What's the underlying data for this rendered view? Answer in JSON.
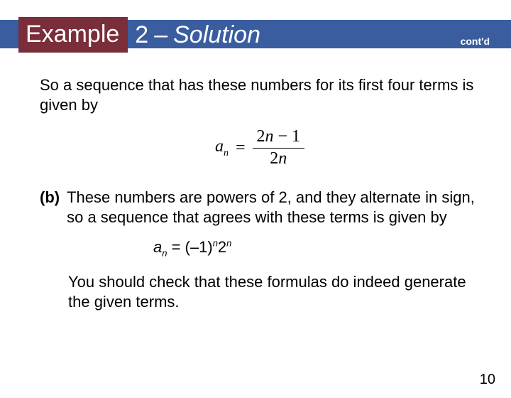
{
  "header": {
    "badge": "Example",
    "number": "2",
    "dash": "–",
    "solution": "Solution",
    "contd": "cont'd"
  },
  "body": {
    "para1": "So a sequence that has these numbers for its first four terms is given by",
    "formula1": {
      "lhs_a": "a",
      "lhs_sub": "n",
      "eq": "=",
      "num_left": "2",
      "num_var": "n",
      "num_right": " − 1",
      "den_left": "2",
      "den_var": "n"
    },
    "partb_label": "(b)",
    "partb_text": "These numbers are powers of 2, and they alternate in sign, so a sequence that agrees with these terms is given by",
    "formula2": {
      "a": "a",
      "sub_n": "n",
      "eq": " = (",
      "neg1": "–1)",
      "sup_n1": "n",
      "two": "2",
      "sup_n2": "n"
    },
    "check": "You should check that these formulas do indeed generate the given terms."
  },
  "page": "10"
}
